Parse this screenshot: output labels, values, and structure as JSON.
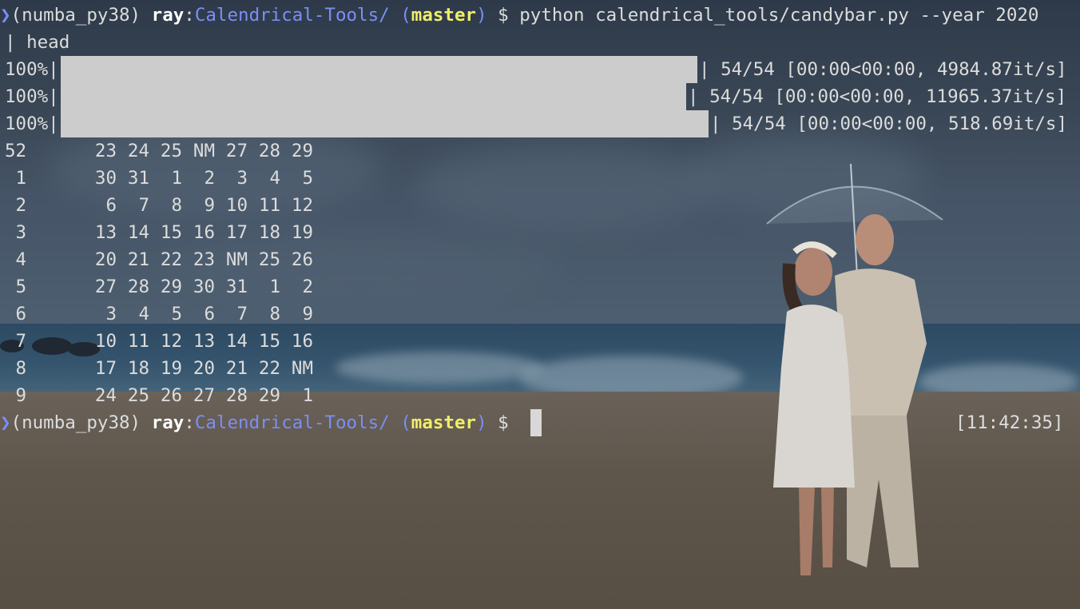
{
  "terminal": {
    "prompt": {
      "arrow": "❯",
      "env": "(numba_py38)",
      "user": "ray",
      "colon": ":",
      "path": "Calendrical-Tools/",
      "branch_open": "(",
      "branch": "master",
      "branch_close": ")",
      "symbol": "$"
    },
    "command_line1": "python calendrical_tools/candybar.py --year 2020",
    "command_line2": "| head",
    "progress": [
      {
        "pct": "100%|",
        "progress": 1.0,
        "stats": "| 54/54 [00:00<00:00, 4984.87it/s]"
      },
      {
        "pct": "100%|",
        "progress": 1.0,
        "stats": "| 54/54 [00:00<00:00, 11965.37it/s]"
      },
      {
        "pct": "100%|",
        "progress": 1.0,
        "stats": "| 54/54 [00:00<00:00, 518.69it/s]"
      }
    ],
    "calendar_rows": [
      {
        "week": "52",
        "days": [
          "23",
          "24",
          "25",
          "NM",
          "27",
          "28",
          "29"
        ]
      },
      {
        "week": " 1",
        "days": [
          "30",
          "31",
          "1",
          "2",
          "3",
          "4",
          "5"
        ]
      },
      {
        "week": " 2",
        "days": [
          "6",
          "7",
          "8",
          "9",
          "10",
          "11",
          "12"
        ]
      },
      {
        "week": " 3",
        "days": [
          "13",
          "14",
          "15",
          "16",
          "17",
          "18",
          "19"
        ]
      },
      {
        "week": " 4",
        "days": [
          "20",
          "21",
          "22",
          "23",
          "NM",
          "25",
          "26"
        ]
      },
      {
        "week": " 5",
        "days": [
          "27",
          "28",
          "29",
          "30",
          "31",
          "1",
          "2"
        ]
      },
      {
        "week": " 6",
        "days": [
          "3",
          "4",
          "5",
          "6",
          "7",
          "8",
          "9"
        ]
      },
      {
        "week": " 7",
        "days": [
          "10",
          "11",
          "12",
          "13",
          "14",
          "15",
          "16"
        ]
      },
      {
        "week": " 8",
        "days": [
          "17",
          "18",
          "19",
          "20",
          "21",
          "22",
          "NM"
        ]
      },
      {
        "week": " 9",
        "days": [
          "24",
          "25",
          "26",
          "27",
          "28",
          "29",
          "1"
        ]
      }
    ],
    "clock": "[11:42:35]"
  },
  "colors": {
    "prompt_blue": "#7b8ef5",
    "branch_yellow": "#f0ee6a",
    "text": "#dcdcdc",
    "bar_fill": "#cccccc"
  }
}
